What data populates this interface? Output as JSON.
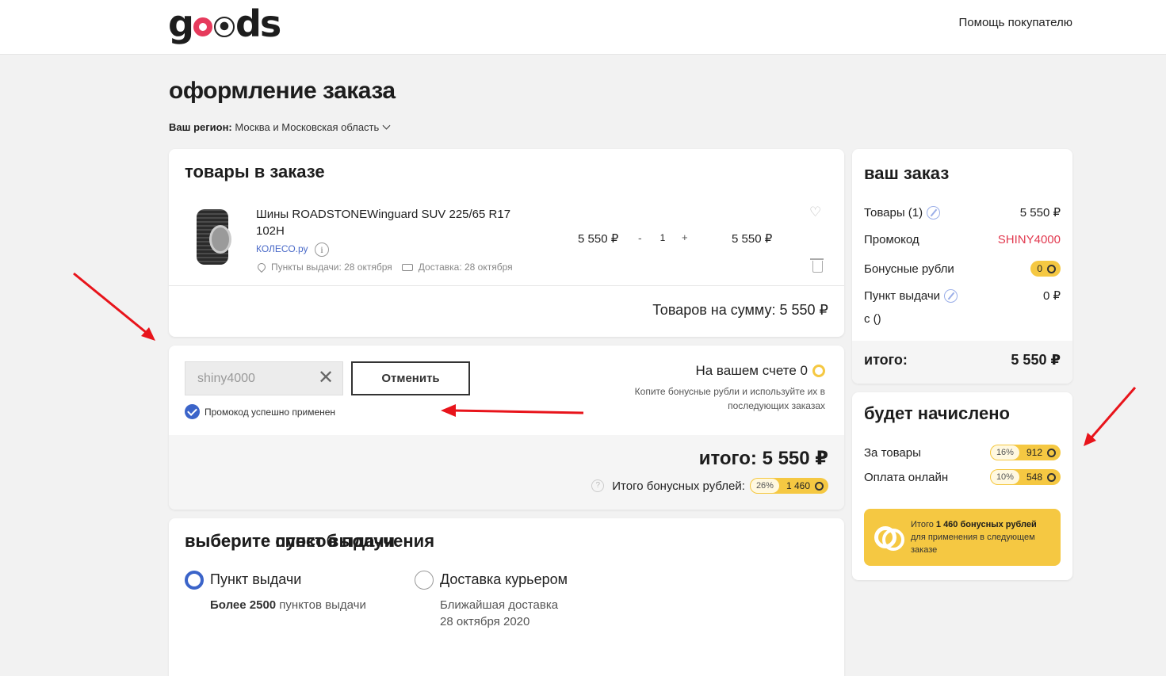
{
  "header": {
    "logo": "goods",
    "help_link": "Помощь покупателю"
  },
  "page": {
    "title": "оформление заказа",
    "region_label": "Ваш регион:",
    "region_value": "Москва и Московская область"
  },
  "goods": {
    "title": "товары в заказе",
    "item": {
      "name": "Шины ROADSTONEWinguard SUV 225/65 R17 102H",
      "seller": "КОЛЕСО.ру",
      "pickup_date": "Пункты выдачи: 28 октября",
      "delivery_date": "Доставка: 28 октября",
      "unit_price": "5 550 ₽",
      "qty_minus": "-",
      "qty": "1",
      "qty_plus": "+",
      "total_price": "5 550 ₽"
    },
    "sum_label": "Товаров на сумму:",
    "sum_value": "5 550 ₽"
  },
  "promo": {
    "code_value": "shiny4000",
    "cancel_label": "Отменить",
    "success_text": "Промокод успешно применен",
    "account_label": "На вашем счете 0",
    "account_hint": "Копите бонусные рубли и используйте их в последующих заказах",
    "grand_total_label": "итого:",
    "grand_total_value": "5 550 ₽",
    "bonus_total_label": "Итого бонусных рублей:",
    "bonus_total_pct": "26%",
    "bonus_total_value": "1 460"
  },
  "delivery": {
    "title": "выберите способ получения",
    "options": [
      {
        "label": "Пункт выдачи",
        "sub_bold": "Более 2500",
        "sub": "пунктов выдачи",
        "selected": true
      },
      {
        "label": "Доставка курьером",
        "sub_line1": "Ближайшая доставка",
        "sub_line2": "28 октября 2020",
        "selected": false
      }
    ],
    "pickup_title": "выберите пункт выдачи"
  },
  "summary": {
    "title": "ваш заказ",
    "rows": [
      {
        "label": "Товары (1)",
        "value": "5 550 ₽"
      },
      {
        "label": "Промокод",
        "value": "SHINY4000"
      },
      {
        "label": "Бонусные рубли",
        "value": "0"
      },
      {
        "label": "Пункт выдачи",
        "value": "0 ₽"
      },
      {
        "label": "с ()",
        "value": ""
      }
    ],
    "total_label": "итого:",
    "total_value": "5 550 ₽"
  },
  "accrual": {
    "title": "будет начислено",
    "rows": [
      {
        "label": "За товары",
        "pct": "16%",
        "value": "912"
      },
      {
        "label": "Оплата онлайн",
        "pct": "10%",
        "value": "548"
      }
    ],
    "banner_prefix": "Итого",
    "banner_bold": "1 460 бонусных рублей",
    "banner_suffix": "для применения в следующем заказе"
  },
  "colors": {
    "accent_blue": "#3b64c9",
    "promo_red": "#e2394f",
    "bonus_yellow": "#f5c842",
    "annotation_red": "#e8141b"
  },
  "icons": [
    "heart-icon",
    "trash-icon",
    "info-icon",
    "clear-icon",
    "check-icon",
    "coin-icon",
    "edit-icon",
    "location-pin-icon",
    "truck-icon",
    "chevron-down-icon"
  ]
}
